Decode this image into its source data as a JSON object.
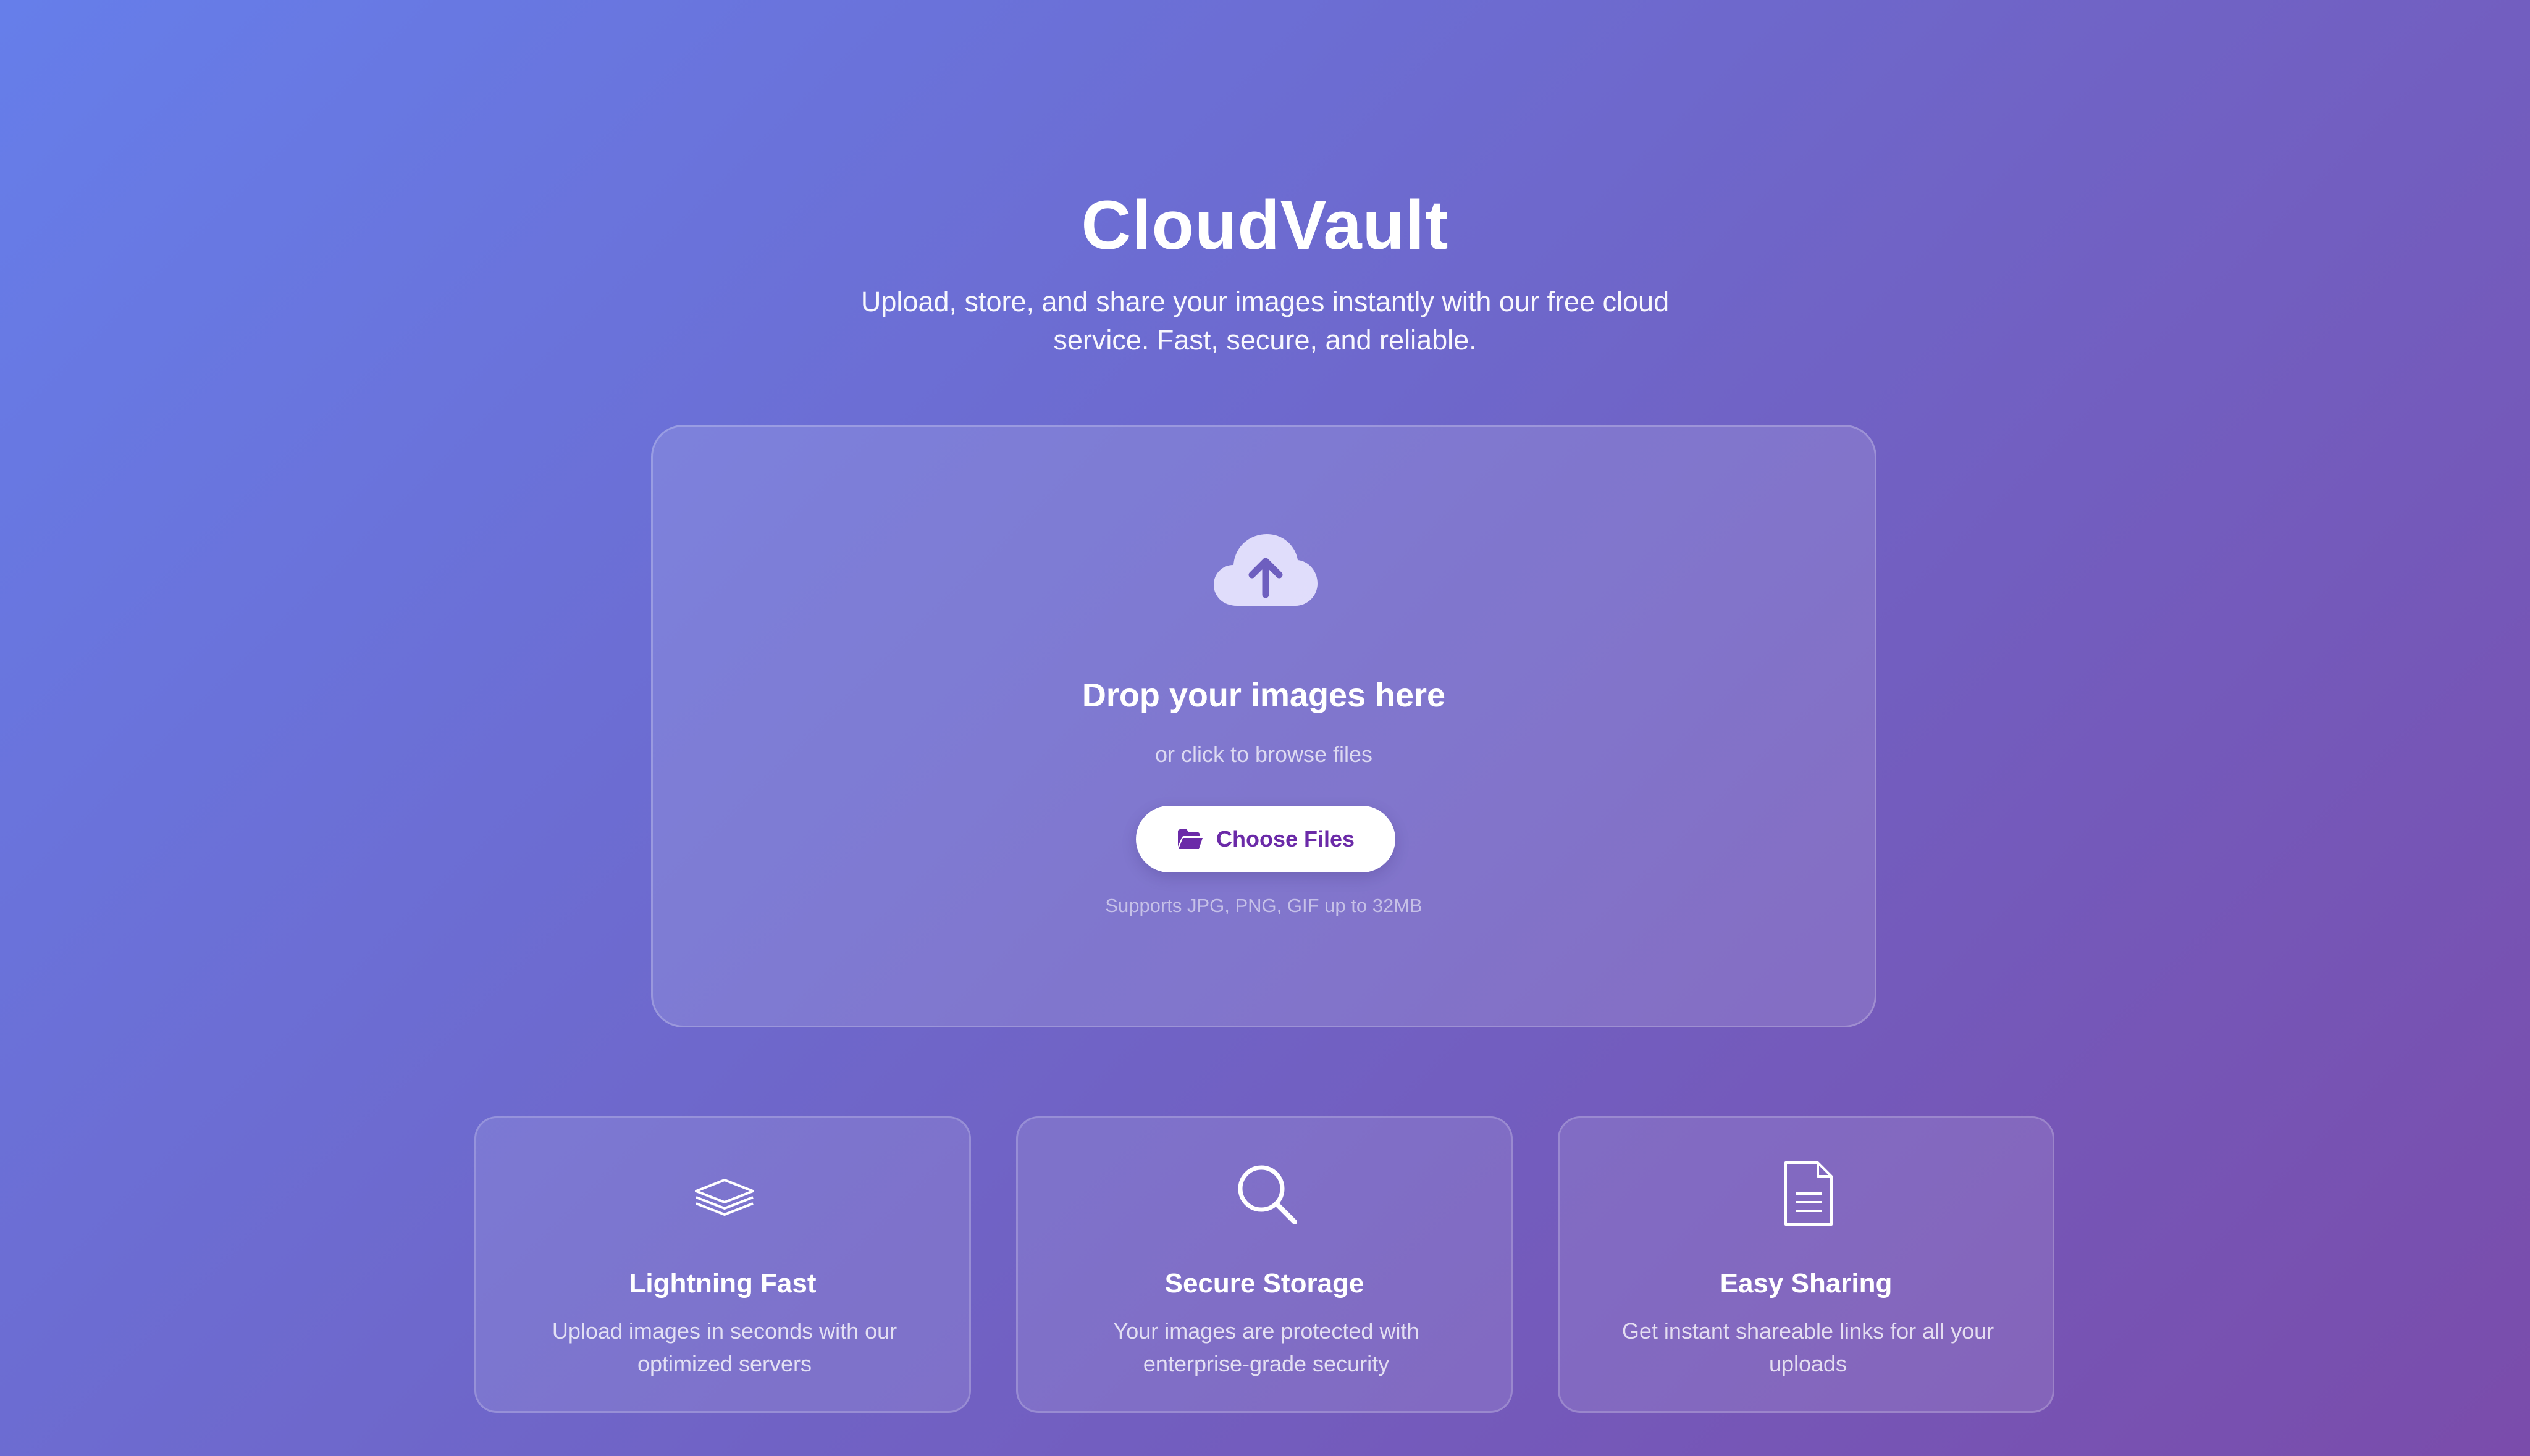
{
  "header": {
    "title": "CloudVault",
    "subtitle": "Upload, store, and share your images instantly with our free cloud service. Fast, secure, and reliable."
  },
  "upload": {
    "icon": "cloud-upload-icon",
    "title": "Drop your images here",
    "subtitle": "or click to browse files",
    "button_icon": "folder-open-icon",
    "button_label": "Choose Files",
    "supports_text": "Supports JPG, PNG, GIF up to 32MB"
  },
  "features": [
    {
      "icon": "layers-icon",
      "title": "Lightning Fast",
      "description": "Upload images in seconds with our optimized servers"
    },
    {
      "icon": "search-icon",
      "title": "Secure Storage",
      "description": "Your images are protected with enterprise-grade security"
    },
    {
      "icon": "document-icon",
      "title": "Easy Sharing",
      "description": "Get instant shareable links for all your uploads"
    }
  ],
  "colors": {
    "gradient_start": "#667eea",
    "gradient_end": "#7a4cab",
    "button_text": "#6b2aa8",
    "button_background": "#ffffff"
  }
}
